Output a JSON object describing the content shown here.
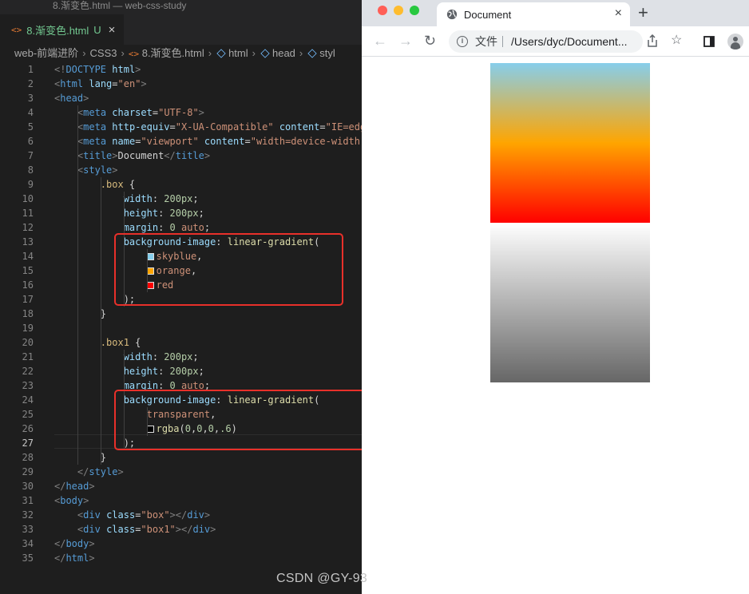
{
  "editor": {
    "window_title": "8.渐变色.html — web-css-study",
    "tab": {
      "icon": "<>",
      "filename": "8.渐变色.html",
      "status": "U",
      "close": "×"
    },
    "breadcrumb": [
      "web-前端进阶",
      "CSS3",
      "8.渐变色.html",
      "html",
      "head",
      "styl"
    ],
    "current_line": 27,
    "lines": [
      {
        "n": 1,
        "c": "<!DOCTYPE html>"
      },
      {
        "n": 2,
        "c": "<html lang=\"en\">"
      },
      {
        "n": 3,
        "c": "<head>"
      },
      {
        "n": 4,
        "c": "    <meta charset=\"UTF-8\">"
      },
      {
        "n": 5,
        "c": "    <meta http-equiv=\"X-UA-Compatible\" content=\"IE=edg"
      },
      {
        "n": 6,
        "c": "    <meta name=\"viewport\" content=\"width=device-width"
      },
      {
        "n": 7,
        "c": "    <title>Document</title>"
      },
      {
        "n": 8,
        "c": "    <style>"
      },
      {
        "n": 9,
        "c": "        .box {"
      },
      {
        "n": 10,
        "c": "            width: 200px;"
      },
      {
        "n": 11,
        "c": "            height: 200px;"
      },
      {
        "n": 12,
        "c": "            margin: 0 auto;"
      },
      {
        "n": 13,
        "c": "            background-image: linear-gradient("
      },
      {
        "n": 14,
        "c": "                skyblue,"
      },
      {
        "n": 15,
        "c": "                orange,"
      },
      {
        "n": 16,
        "c": "                red"
      },
      {
        "n": 17,
        "c": "            );"
      },
      {
        "n": 18,
        "c": "        }"
      },
      {
        "n": 19,
        "c": ""
      },
      {
        "n": 20,
        "c": "        .box1 {"
      },
      {
        "n": 21,
        "c": "            width: 200px;"
      },
      {
        "n": 22,
        "c": "            height: 200px;"
      },
      {
        "n": 23,
        "c": "            margin: 0 auto;"
      },
      {
        "n": 24,
        "c": "            background-image: linear-gradient("
      },
      {
        "n": 25,
        "c": "                transparent,"
      },
      {
        "n": 26,
        "c": "                rgba(0,0,0,.6)"
      },
      {
        "n": 27,
        "c": "            );"
      },
      {
        "n": 28,
        "c": "        }"
      },
      {
        "n": 29,
        "c": "    </style>"
      },
      {
        "n": 30,
        "c": "</head>"
      },
      {
        "n": 31,
        "c": "<body>"
      },
      {
        "n": 32,
        "c": "    <div class=\"box\"></div>"
      },
      {
        "n": 33,
        "c": "    <div class=\"box1\"></div>"
      },
      {
        "n": 34,
        "c": "</body>"
      },
      {
        "n": 35,
        "c": "</html>"
      }
    ],
    "swatches": {
      "skyblue": "#87ceeb",
      "orange": "#ffa500",
      "red": "#ff0000",
      "rgba": "rgba(0,0,0,.6)"
    },
    "highlight_color": "#e8302a"
  },
  "browser": {
    "tab_title": "Document",
    "tab_close": "×",
    "new_tab": "+",
    "address_label": "文件",
    "address_url": "/Users/dyc/Document...",
    "box_gradient": [
      "skyblue",
      "orange",
      "red"
    ],
    "box1_gradient": [
      "transparent",
      "rgba(0,0,0,.6)"
    ]
  },
  "watermark": "CSDN @GY-93"
}
